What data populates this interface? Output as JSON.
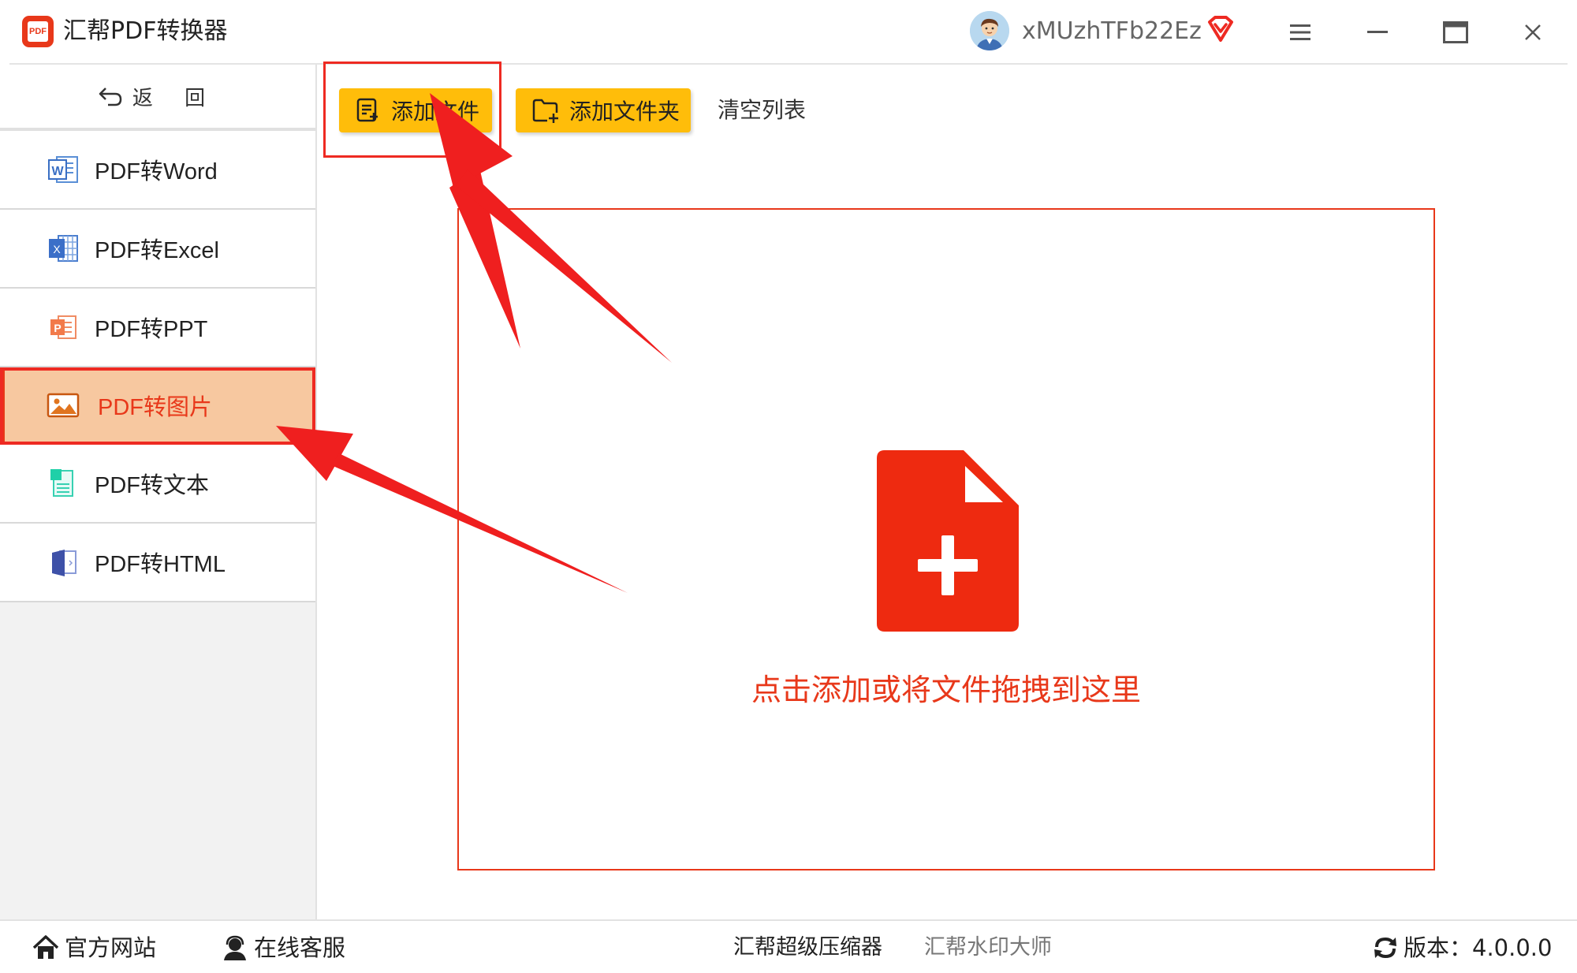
{
  "app": {
    "title": "汇帮PDF转换器",
    "logo_text": "PDF",
    "username": "xMUzhTFb22Ez"
  },
  "colors": {
    "accent_red": "#e8381a",
    "button_yellow": "#ffbd0a",
    "active_bg": "#f7c8a0"
  },
  "sidebar": {
    "back_label": "返 回",
    "items": [
      {
        "label": "PDF转Word",
        "icon": "word-icon",
        "active": false
      },
      {
        "label": "PDF转Excel",
        "icon": "excel-icon",
        "active": false
      },
      {
        "label": "PDF转PPT",
        "icon": "ppt-icon",
        "active": false
      },
      {
        "label": "PDF转图片",
        "icon": "image-icon",
        "active": true
      },
      {
        "label": "PDF转文本",
        "icon": "text-icon",
        "active": false
      },
      {
        "label": "PDF转HTML",
        "icon": "html-icon",
        "active": false
      }
    ]
  },
  "toolbar": {
    "add_file_label": "添加文件",
    "add_folder_label": "添加文件夹",
    "clear_label": "清空列表"
  },
  "dropzone": {
    "hint": "点击添加或将文件拖拽到这里",
    "icon": "add-file-icon"
  },
  "footer": {
    "website_label": "官方网站",
    "support_label": "在线客服",
    "compressor_label": "汇帮超级压缩器",
    "watermark_label": "汇帮水印大师",
    "version_label": "版本：",
    "version_value": "4.0.0.0"
  }
}
